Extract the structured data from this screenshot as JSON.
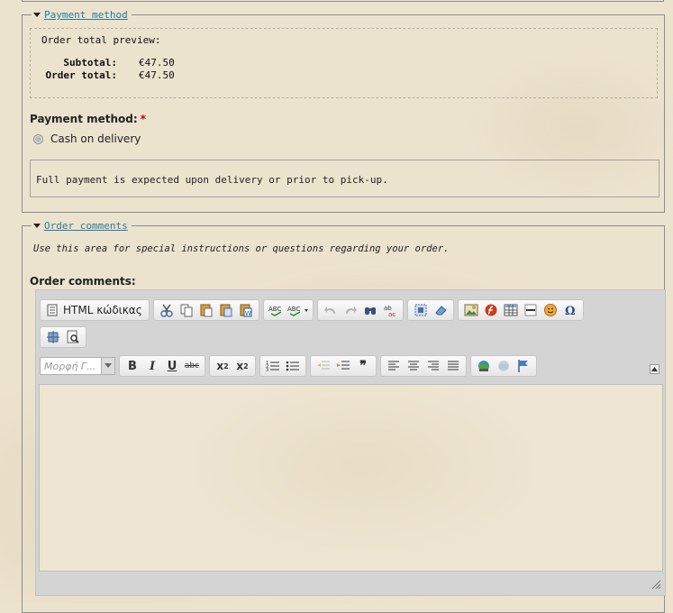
{
  "payment": {
    "legend": "Payment method",
    "preview_title": "Order total preview:",
    "totals": [
      {
        "label": "Subtotal:",
        "value": "€47.50"
      },
      {
        "label": "Order total:",
        "value": "€47.50"
      }
    ],
    "method_label": "Payment method:",
    "required_mark": "*",
    "option": "Cash on delivery",
    "note": "Full payment is expected upon delivery or prior to pick-up."
  },
  "comments": {
    "legend": "Order comments",
    "help": "Use this area for special instructions or questions regarding your order.",
    "label": "Order comments:"
  },
  "editor": {
    "source_button": "HTML κώδικας",
    "format_placeholder": "Μορφή Γ...",
    "buttons": [
      "bold",
      "italic",
      "underline",
      "strike"
    ]
  },
  "colors": {
    "link": "#2a7a9a",
    "required": "#cc0000",
    "page_bg": "#ece3cf"
  }
}
